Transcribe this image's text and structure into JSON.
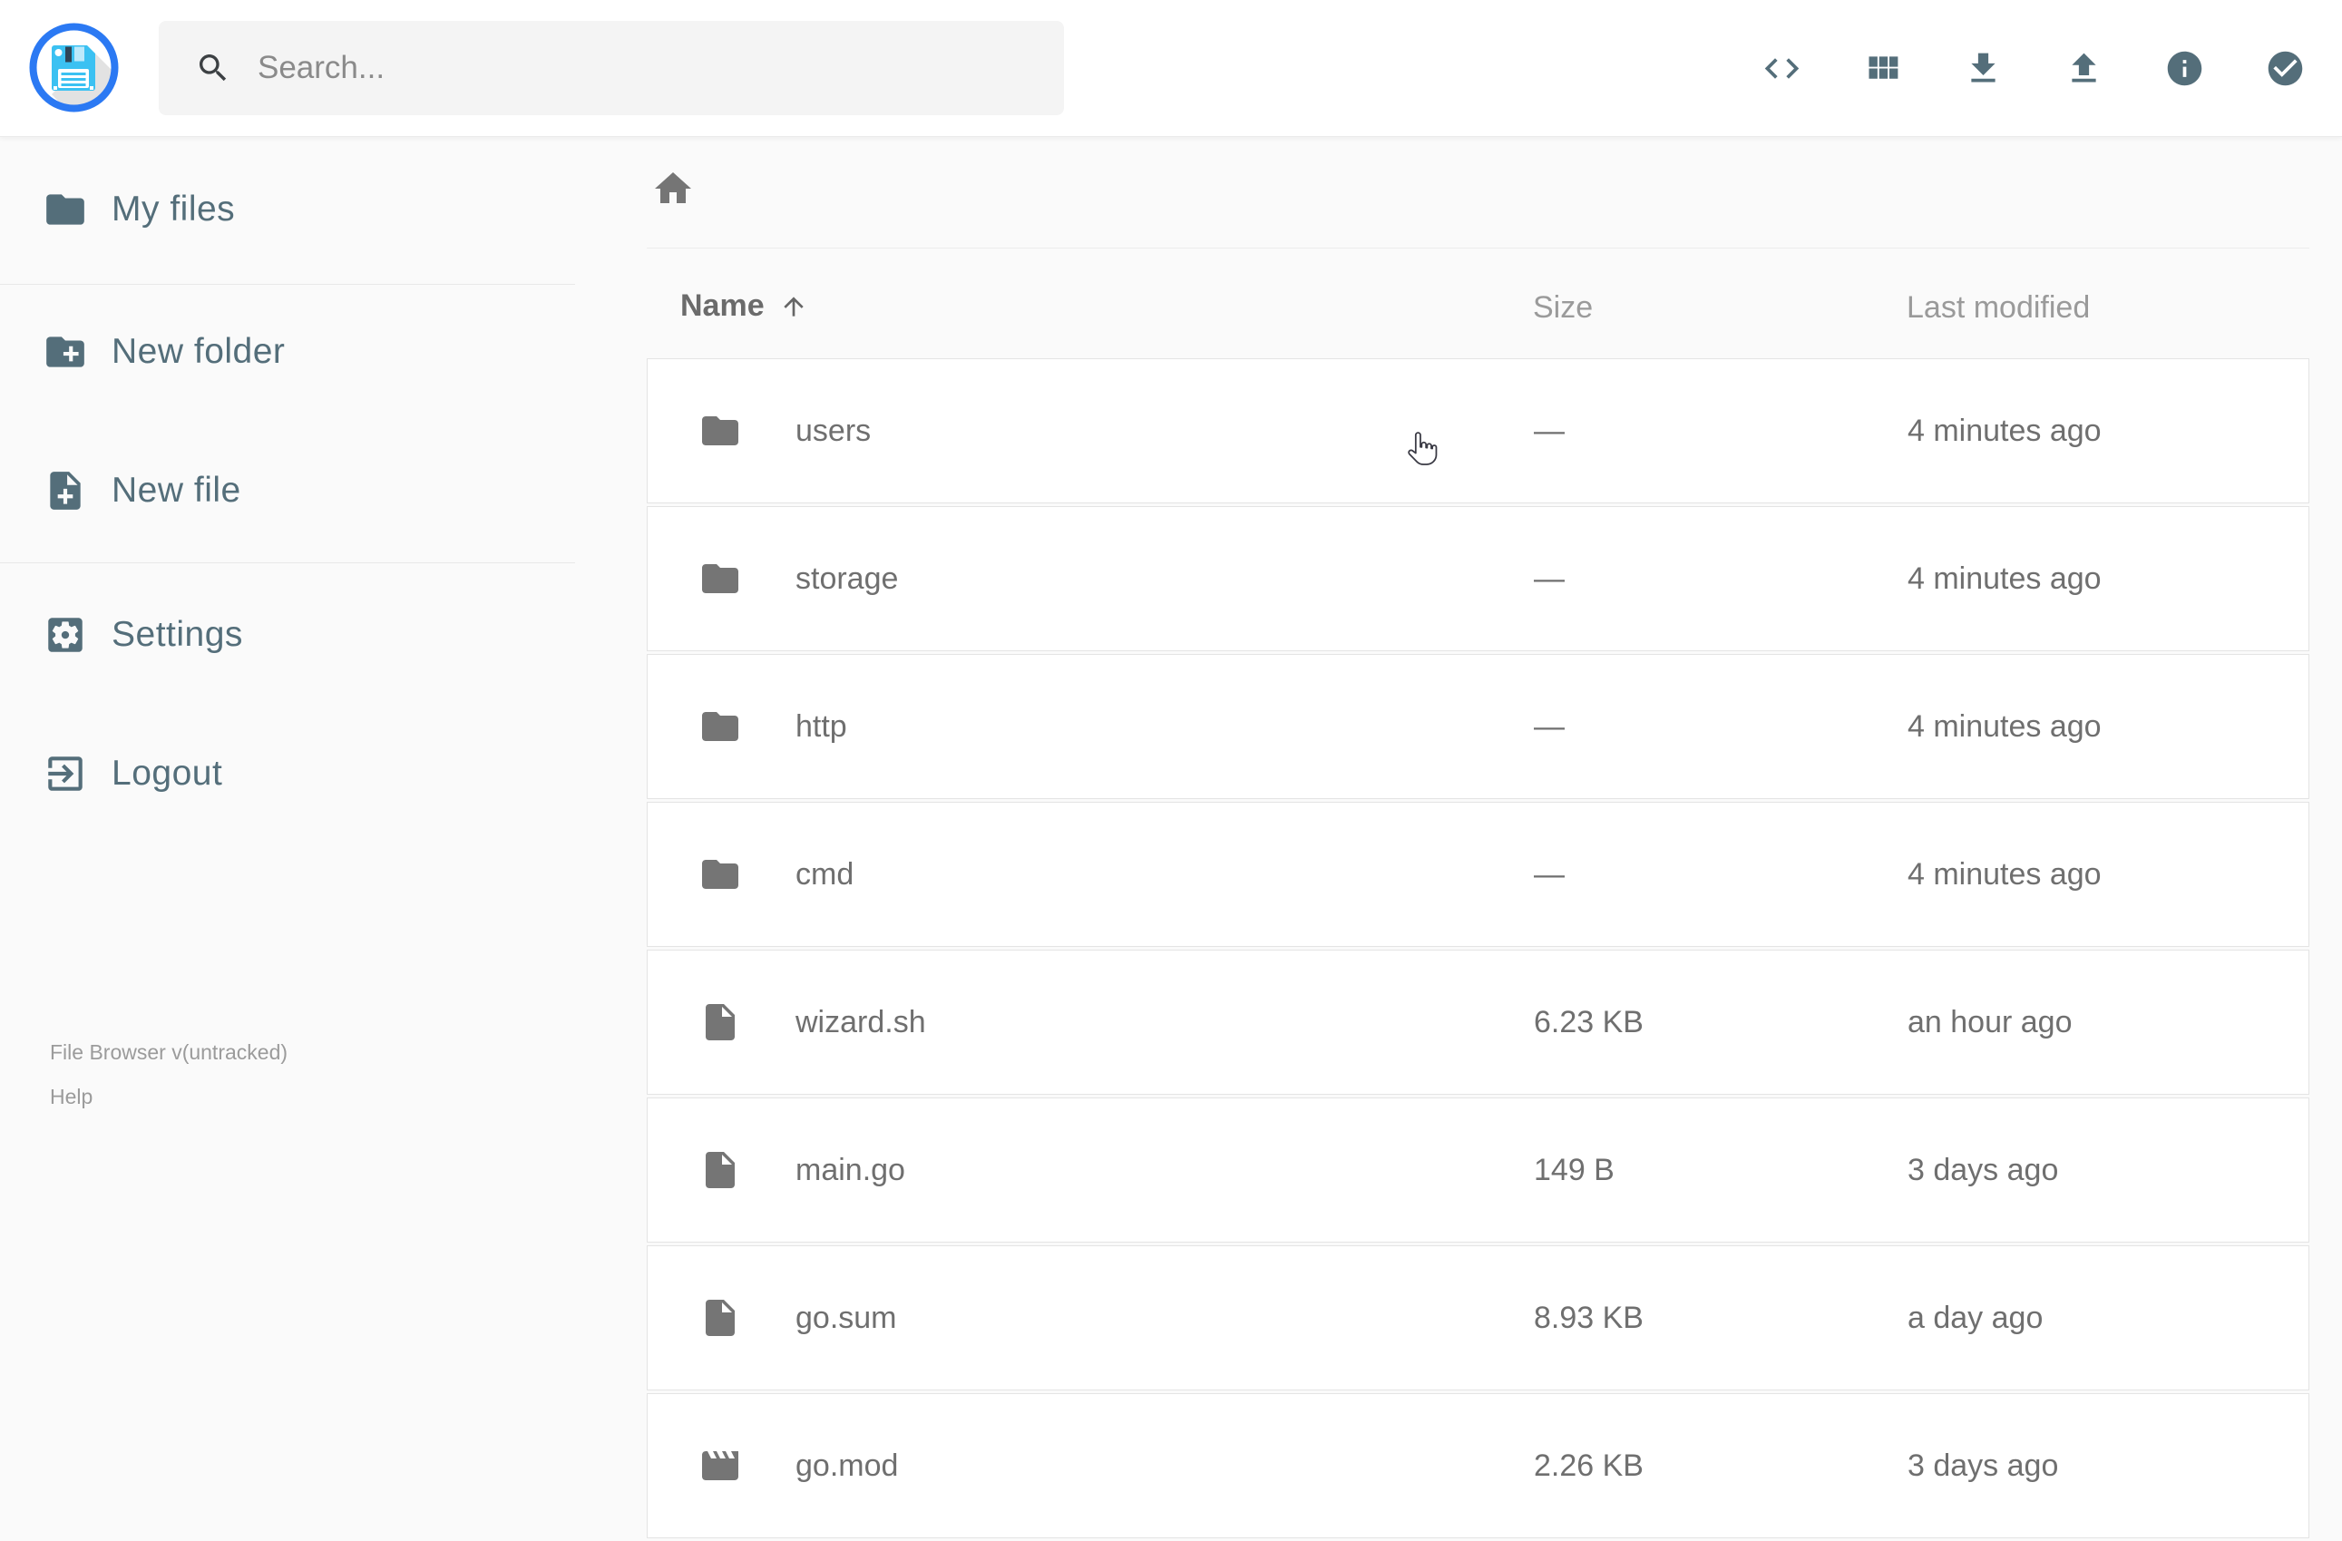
{
  "colors": {
    "accent_slate": "#546e7a",
    "logo_ring_blue": "#2b79f3",
    "floppy_blue": "#3bc1f2",
    "background": "#fafafa",
    "row_text_gray": "#6f6f6f"
  },
  "header": {
    "search": {
      "placeholder": "Search...",
      "icon": "search-icon"
    },
    "actions": [
      {
        "name": "shell",
        "icon": "code-icon"
      },
      {
        "name": "switch-view",
        "icon": "view-module-icon"
      },
      {
        "name": "download",
        "icon": "download-icon"
      },
      {
        "name": "upload",
        "icon": "upload-icon"
      },
      {
        "name": "info",
        "icon": "info-icon"
      },
      {
        "name": "select-multiple",
        "icon": "check-circle-icon"
      }
    ]
  },
  "sidebar": {
    "items": [
      {
        "label": "My files",
        "icon": "folder-icon"
      },
      {
        "label": "New folder",
        "icon": "create-new-folder-icon"
      },
      {
        "label": "New file",
        "icon": "new-file-icon"
      },
      {
        "label": "Settings",
        "icon": "settings-icon"
      },
      {
        "label": "Logout",
        "icon": "logout-icon"
      }
    ],
    "footer": {
      "version": "File Browser v(untracked)",
      "help_label": "Help"
    }
  },
  "breadcrumb": {
    "home_icon": "home-icon"
  },
  "listing": {
    "columns": {
      "name": "Name",
      "size": "Size",
      "modified": "Last modified"
    },
    "sort": {
      "column": "Name",
      "direction": "ascending",
      "icon": "arrow-upward-icon"
    },
    "rows": [
      {
        "name": "users",
        "icon": "folder-icon",
        "size": "—",
        "modified": "4 minutes ago"
      },
      {
        "name": "storage",
        "icon": "folder-icon",
        "size": "—",
        "modified": "4 minutes ago"
      },
      {
        "name": "http",
        "icon": "folder-icon",
        "size": "—",
        "modified": "4 minutes ago"
      },
      {
        "name": "cmd",
        "icon": "folder-icon",
        "size": "—",
        "modified": "4 minutes ago"
      },
      {
        "name": "wizard.sh",
        "icon": "file-icon",
        "size": "6.23 KB",
        "modified": "an hour ago"
      },
      {
        "name": "main.go",
        "icon": "file-icon",
        "size": "149 B",
        "modified": "3 days ago"
      },
      {
        "name": "go.sum",
        "icon": "file-icon",
        "size": "8.93 KB",
        "modified": "a day ago"
      },
      {
        "name": "go.mod",
        "icon": "movie-icon",
        "size": "2.26 KB",
        "modified": "3 days ago"
      }
    ]
  },
  "cursor": {
    "icon": "hand-pointer-cursor",
    "visible": true
  }
}
